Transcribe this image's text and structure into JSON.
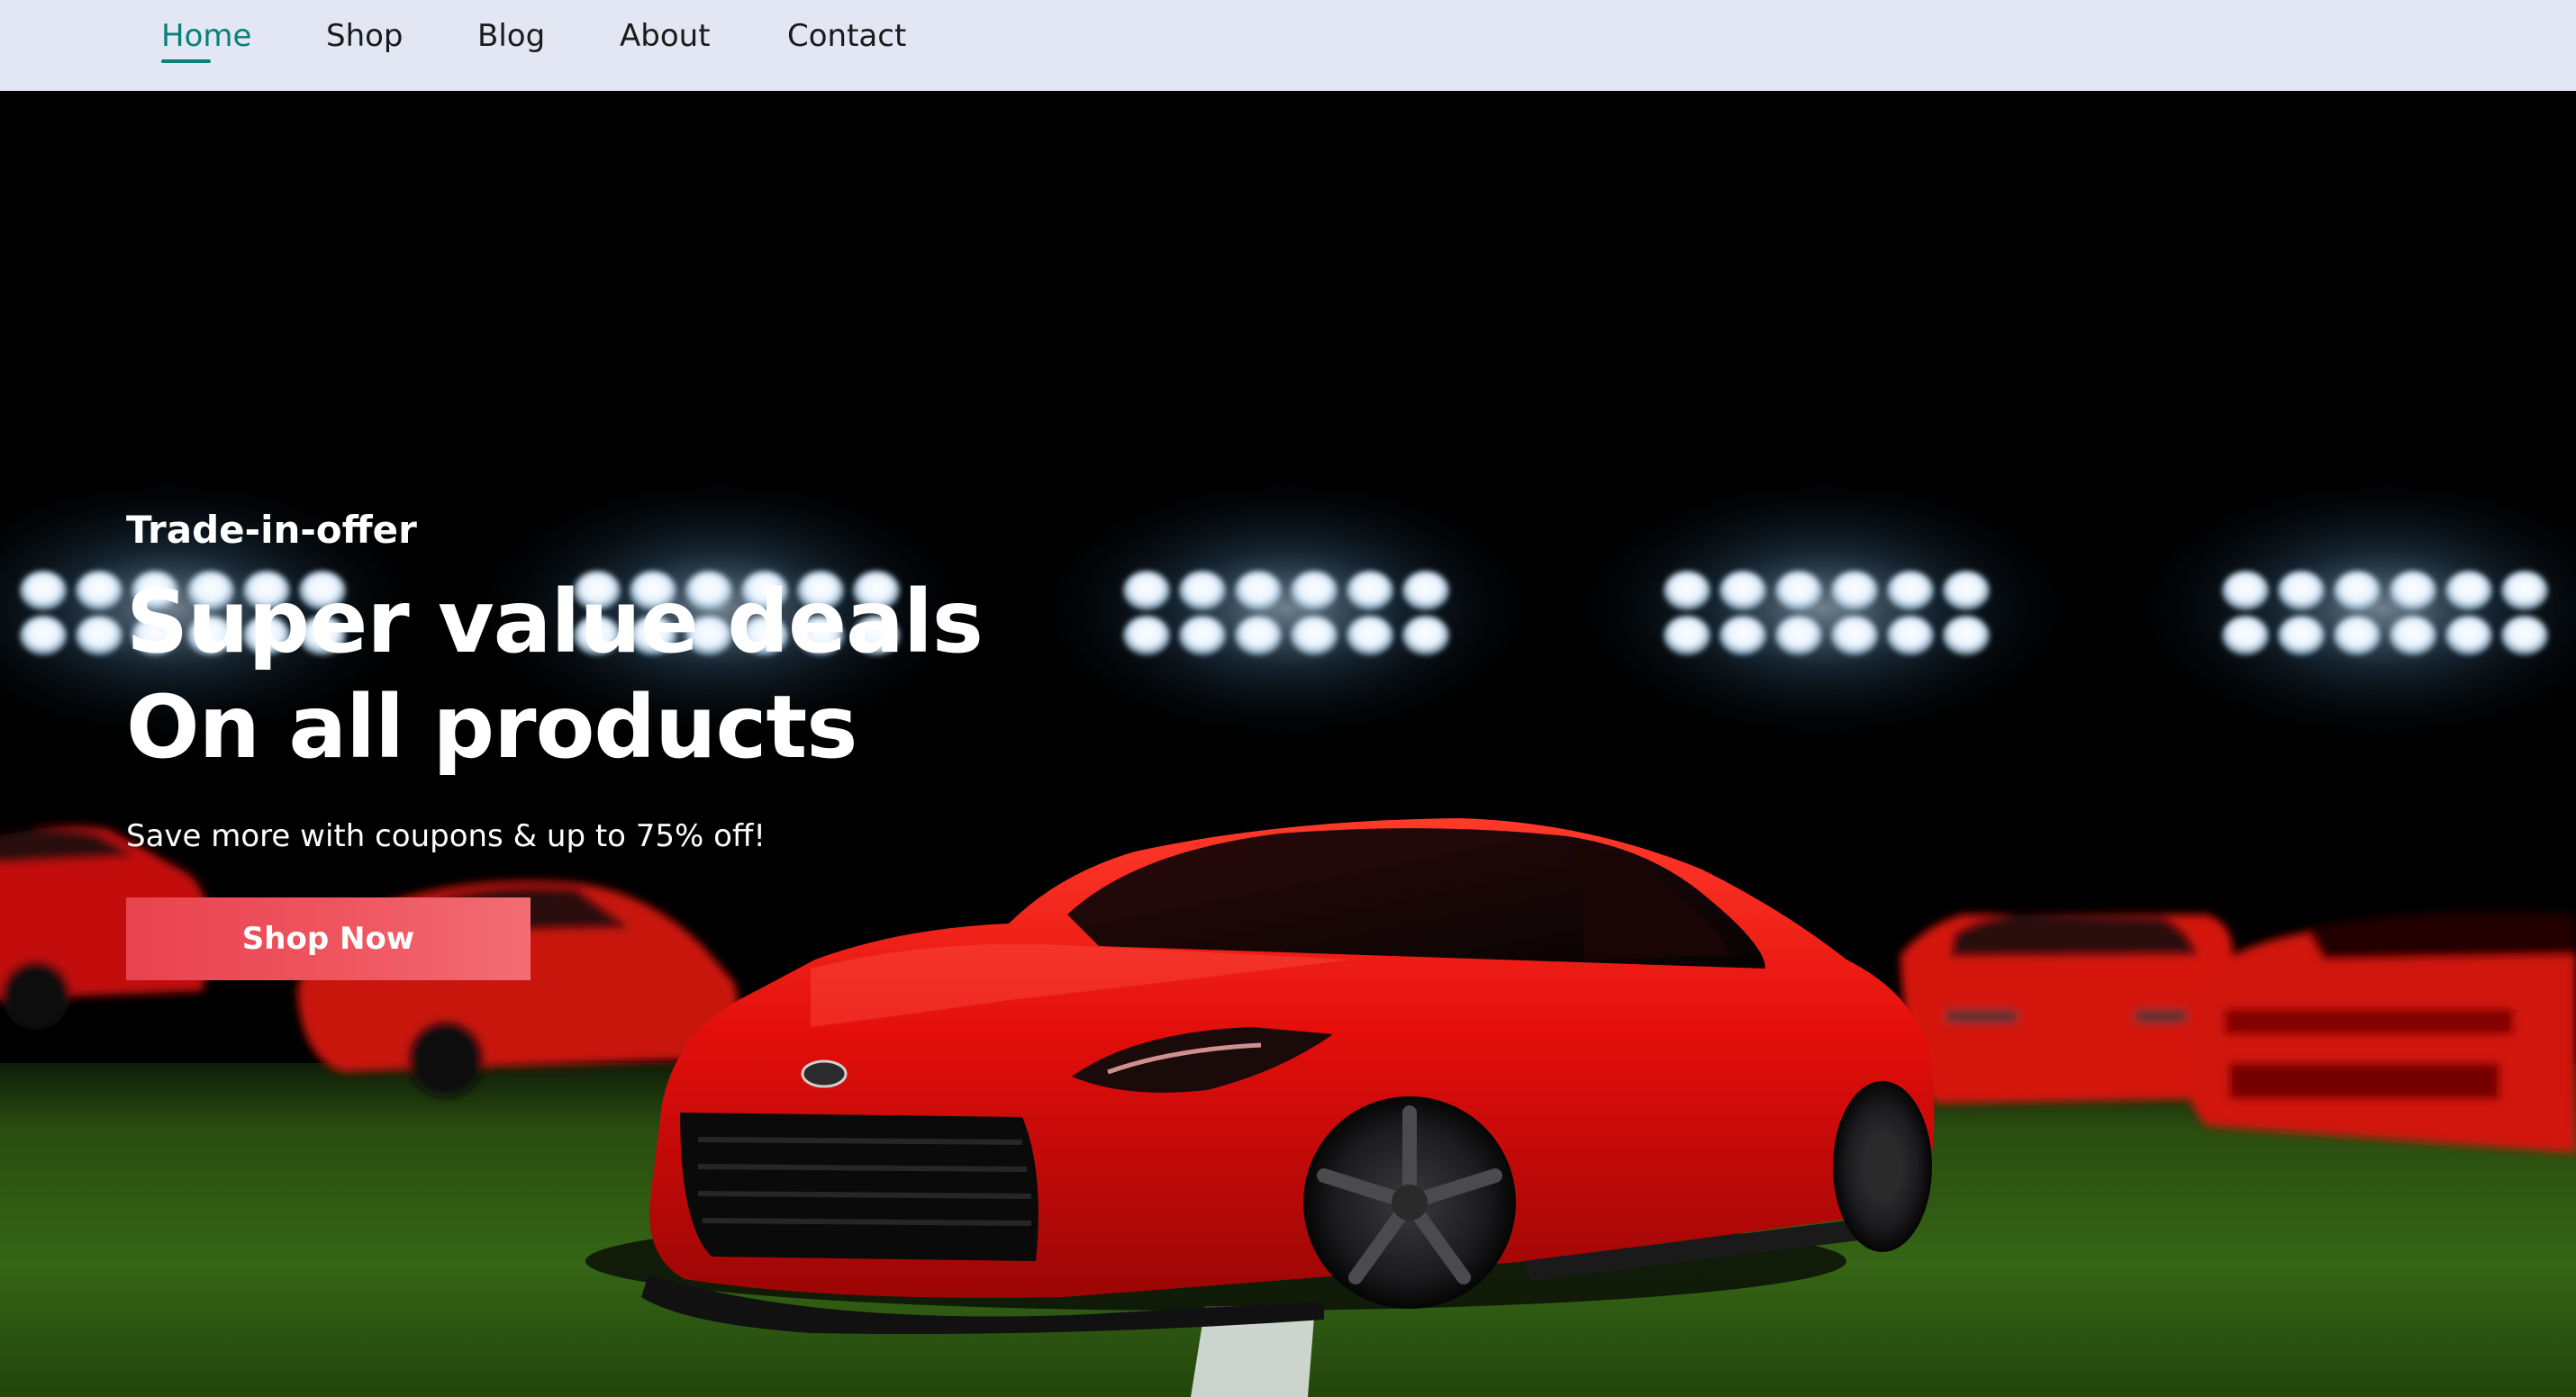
{
  "nav": {
    "items": [
      {
        "label": "Home",
        "active": true
      },
      {
        "label": "Shop",
        "active": false
      },
      {
        "label": "Blog",
        "active": false
      },
      {
        "label": "About",
        "active": false
      },
      {
        "label": "Contact",
        "active": false
      }
    ]
  },
  "hero": {
    "kicker": "Trade-in-offer",
    "headline_line1": "Super value deals",
    "headline_line2": "On all products",
    "subtext": "Save more with coupons & up to 75% off!",
    "cta_label": "Shop Now"
  },
  "colors": {
    "nav_bg": "#e3e6f3",
    "nav_active": "#088178",
    "cta": "#e8434f",
    "car_red": "#e40d0d",
    "turf": "#2f5a12"
  }
}
